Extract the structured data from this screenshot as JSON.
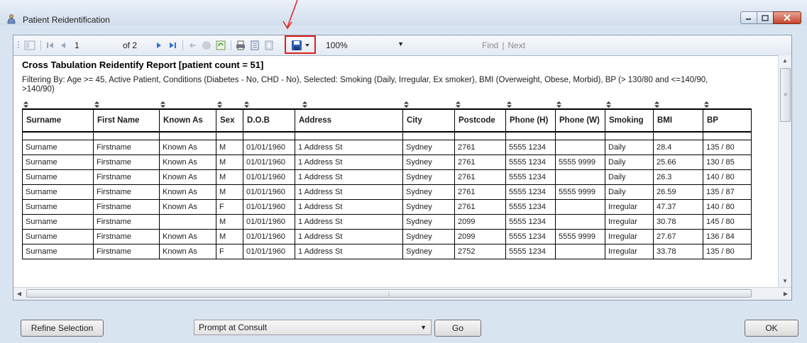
{
  "window": {
    "title": "Patient Reidentification"
  },
  "toolbar": {
    "page_current": "1",
    "page_of": "of 2",
    "zoom": "100%",
    "find_label": "Find",
    "next_label": "Next",
    "separator": "|"
  },
  "report": {
    "title": "Cross Tabulation Reidentify Report  [patient count = 51]",
    "filter_text": "Filtering By: Age >= 45, Active Patient, Conditions (Diabetes - No, CHD - No), Selected: Smoking (Daily, Irregular, Ex smoker), BMI (Overweight, Obese, Morbid), BP (> 130/80 and <=140/90, >140/90)",
    "columns": [
      "Surname",
      "First Name",
      "Known As",
      "Sex",
      "D.O.B",
      "Address",
      "City",
      "Postcode",
      "Phone (H)",
      "Phone (W)",
      "Smoking",
      "BMI",
      "BP"
    ],
    "rows": [
      [
        "Surname",
        "Firstname",
        "Known As",
        "M",
        "01/01/1960",
        "1 Address St",
        "Sydney",
        "2761",
        "5555 1234",
        "",
        "Daily",
        "28.4",
        "135 / 80"
      ],
      [
        "Surname",
        "Firstname",
        "Known As",
        "M",
        "01/01/1960",
        "1 Address St",
        "Sydney",
        "2761",
        "5555 1234",
        "5555 9999",
        "Daily",
        "25.66",
        "130 / 85"
      ],
      [
        "Surname",
        "Firstname",
        "Known As",
        "M",
        "01/01/1960",
        "1 Address St",
        "Sydney",
        "2761",
        "5555 1234",
        "",
        "Daily",
        "26.3",
        "140 / 80"
      ],
      [
        "Surname",
        "Firstname",
        "Known As",
        "M",
        "01/01/1960",
        "1 Address St",
        "Sydney",
        "2761",
        "5555 1234",
        "5555 9999",
        "Daily",
        "26.59",
        "135 / 87"
      ],
      [
        "Surname",
        "Firstname",
        "Known As",
        "F",
        "01/01/1960",
        "1 Address St",
        "Sydney",
        "2761",
        "5555 1234",
        "",
        "Irregular",
        "47.37",
        "140 / 80"
      ],
      [
        "Surname",
        "Firstname",
        "",
        "M",
        "01/01/1960",
        "1 Address St",
        "Sydney",
        "2099",
        "5555 1234",
        "",
        "Irregular",
        "30.78",
        "145 / 80"
      ],
      [
        "Surname",
        "Firstname",
        "Known As",
        "M",
        "01/01/1960",
        "1 Address St",
        "Sydney",
        "2099",
        "5555 1234",
        "5555 9999",
        "Irregular",
        "27.67",
        "136 / 84"
      ],
      [
        "Surname",
        "Firstname",
        "Known As",
        "F",
        "01/01/1960",
        "1 Address St",
        "Sydney",
        "2752",
        "5555 1234",
        "",
        "Irregular",
        "33.78",
        "135 / 80"
      ]
    ]
  },
  "bottom": {
    "refine_label": "Refine Selection",
    "prompt_value": "Prompt at Consult",
    "go_label": "Go",
    "ok_label": "OK"
  },
  "colors": {
    "highlight": "#e0201c",
    "arrow": "#e0201c"
  }
}
